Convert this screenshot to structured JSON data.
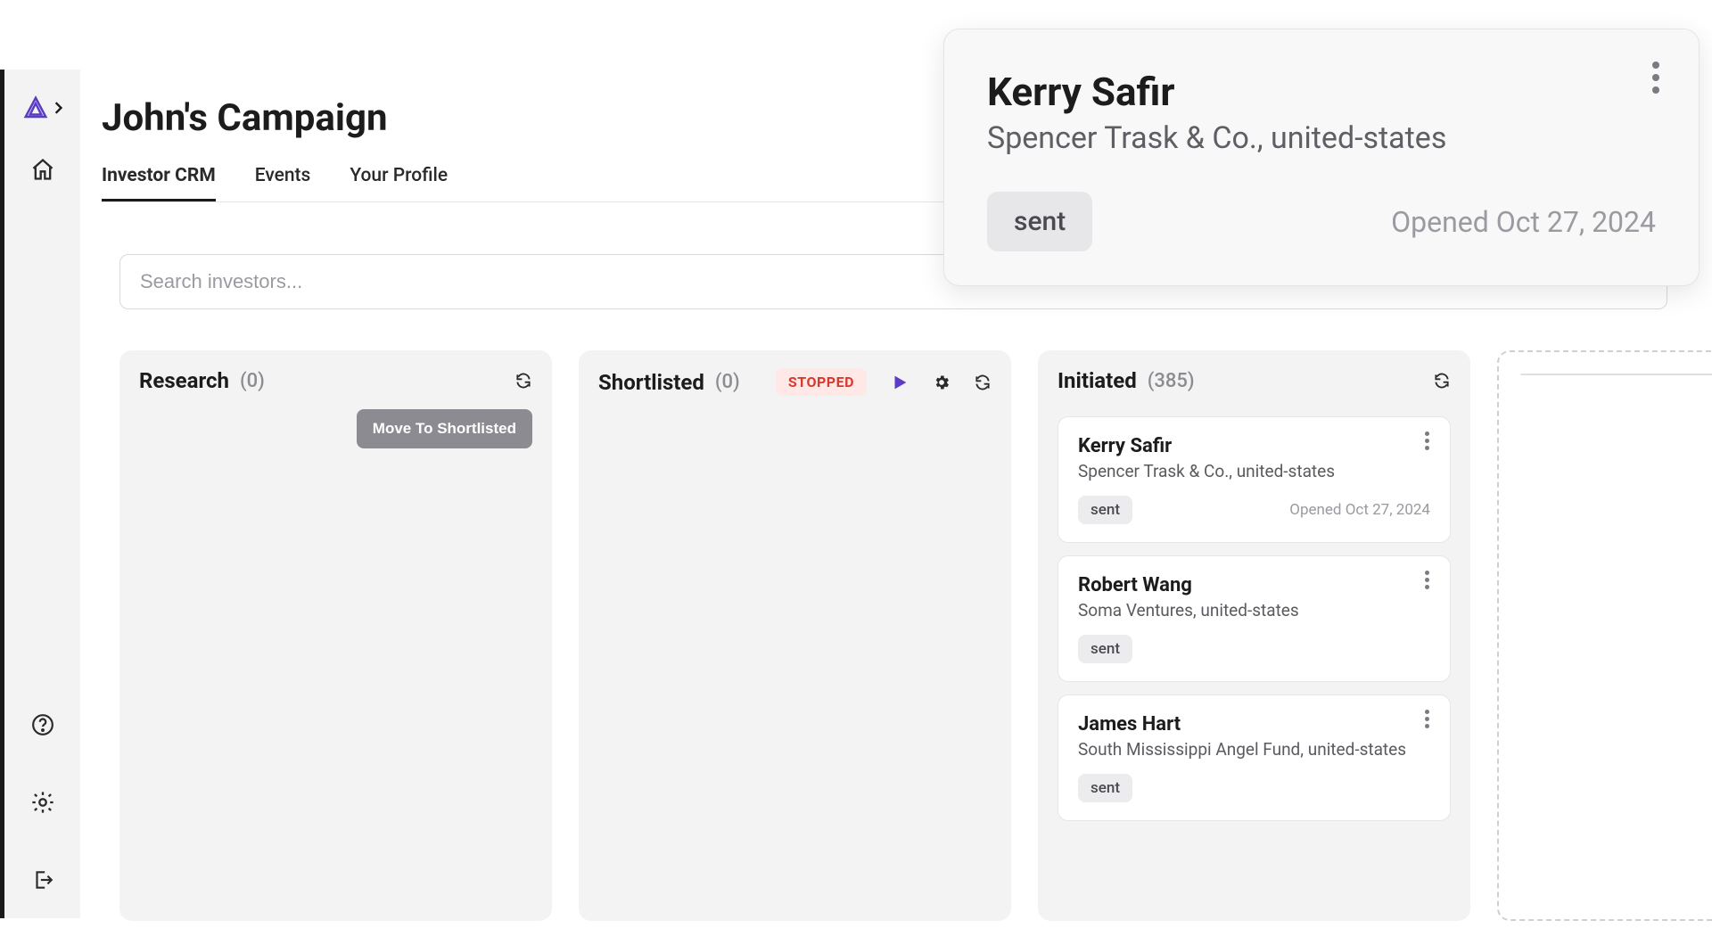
{
  "page": {
    "title": "John's Campaign"
  },
  "tabs": [
    {
      "label": "Investor CRM",
      "active": true
    },
    {
      "label": "Events",
      "active": false
    },
    {
      "label": "Your Profile",
      "active": false
    }
  ],
  "search": {
    "placeholder": "Search investors..."
  },
  "columns": {
    "research": {
      "title": "Research",
      "count": "(0)",
      "move_button": "Move To Shortlisted"
    },
    "shortlisted": {
      "title": "Shortlisted",
      "count": "(0)",
      "status_badge": "STOPPED"
    },
    "initiated": {
      "title": "Initiated",
      "count": "(385)",
      "cards": [
        {
          "name": "Kerry Safir",
          "subtitle": "Spencer Trask & Co., united-states",
          "chip": "sent",
          "meta": "Opened Oct 27, 2024"
        },
        {
          "name": "Robert Wang",
          "subtitle": "Soma Ventures, united-states",
          "chip": "sent",
          "meta": ""
        },
        {
          "name": "James Hart",
          "subtitle": "South Mississippi Angel Fund, united-states",
          "chip": "sent",
          "meta": ""
        }
      ]
    }
  },
  "popup": {
    "name": "Kerry Safir",
    "subtitle": "Spencer Trask & Co., united-states",
    "chip": "sent",
    "meta": "Opened Oct 27, 2024"
  }
}
